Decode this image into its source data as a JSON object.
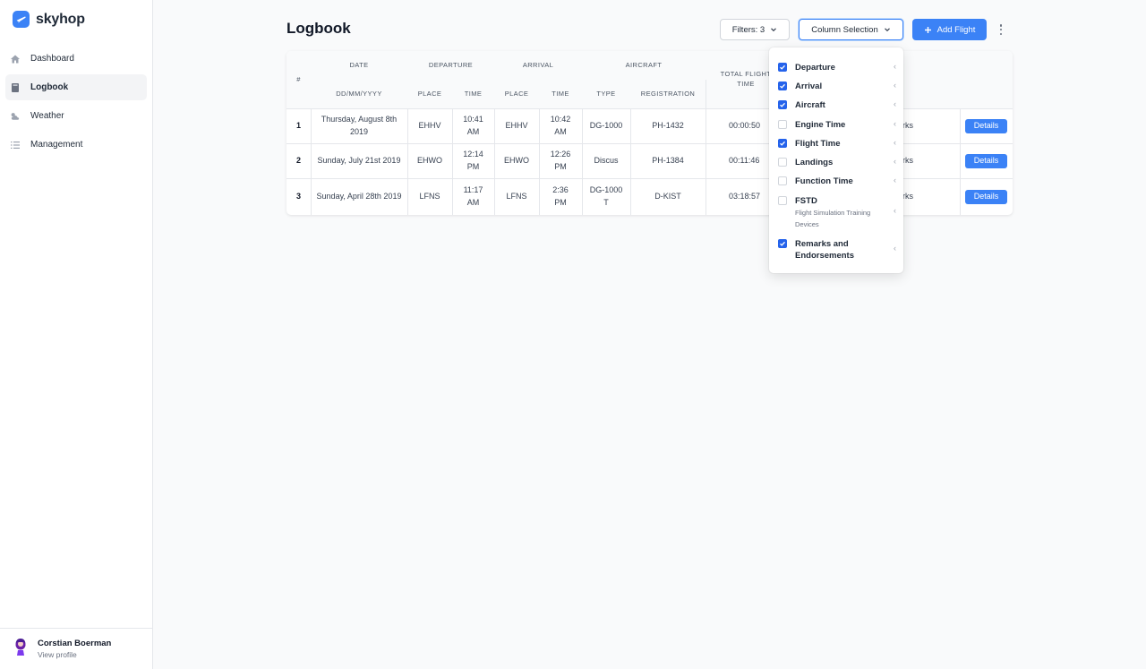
{
  "brand": {
    "name": "skyhop"
  },
  "sidebar": {
    "items": [
      {
        "label": "Dashboard",
        "icon": "home-icon"
      },
      {
        "label": "Logbook",
        "icon": "book-icon",
        "active": true
      },
      {
        "label": "Weather",
        "icon": "cloud-sun-icon"
      },
      {
        "label": "Management",
        "icon": "list-check-icon"
      }
    ]
  },
  "profile": {
    "name": "Corstian Boerman",
    "link": "View profile"
  },
  "page": {
    "title": "Logbook"
  },
  "toolbar": {
    "filters_label": "Filters: 3",
    "columns_label": "Column Selection",
    "add_label": "Add Flight"
  },
  "table": {
    "headers": {
      "num": "#",
      "date": "Date",
      "date_format": "DD/MM/YYYY",
      "departure": "Departure",
      "arrival": "Arrival",
      "aircraft": "Aircraft",
      "place": "Place",
      "time": "Time",
      "type": "Type",
      "registration": "Registration",
      "total_flight_time": "Total Flight Time",
      "remarks": "Remarks and Endorsements"
    },
    "rows": [
      {
        "num": "1",
        "date": "Thursday, August 8th 2019",
        "dep_place": "EHHV",
        "dep_time": "10:41 AM",
        "arr_place": "EHHV",
        "arr_time": "10:42 AM",
        "type": "DG-1000",
        "registration": "PH-1432",
        "total": "00:00:50",
        "remarks": "Remarks",
        "action": "Details"
      },
      {
        "num": "2",
        "date": "Sunday, July 21st 2019",
        "dep_place": "EHWO",
        "dep_time": "12:14 PM",
        "arr_place": "EHWO",
        "arr_time": "12:26 PM",
        "type": "Discus",
        "registration": "PH-1384",
        "total": "00:11:46",
        "remarks": "Remarks",
        "action": "Details"
      },
      {
        "num": "3",
        "date": "Sunday, April 28th 2019",
        "dep_place": "LFNS",
        "dep_time": "11:17 AM",
        "arr_place": "LFNS",
        "arr_time": "2:36 PM",
        "type": "DG-1000 T",
        "registration": "D-KIST",
        "total": "03:18:57",
        "remarks": "Remarks",
        "action": "Details"
      }
    ]
  },
  "column_selection": {
    "items": [
      {
        "label": "Departure",
        "checked": true
      },
      {
        "label": "Arrival",
        "checked": true
      },
      {
        "label": "Aircraft",
        "checked": true
      },
      {
        "label": "Engine Time",
        "checked": false
      },
      {
        "label": "Flight Time",
        "checked": true
      },
      {
        "label": "Landings",
        "checked": false
      },
      {
        "label": "Function Time",
        "checked": false
      },
      {
        "label": "FSTD",
        "sub": "Flight Simulation Training Devices",
        "checked": false
      },
      {
        "label": "Remarks and Endorsements",
        "checked": true
      }
    ]
  },
  "colors": {
    "accent": "#3b82f6",
    "checkbox": "#2563eb"
  }
}
